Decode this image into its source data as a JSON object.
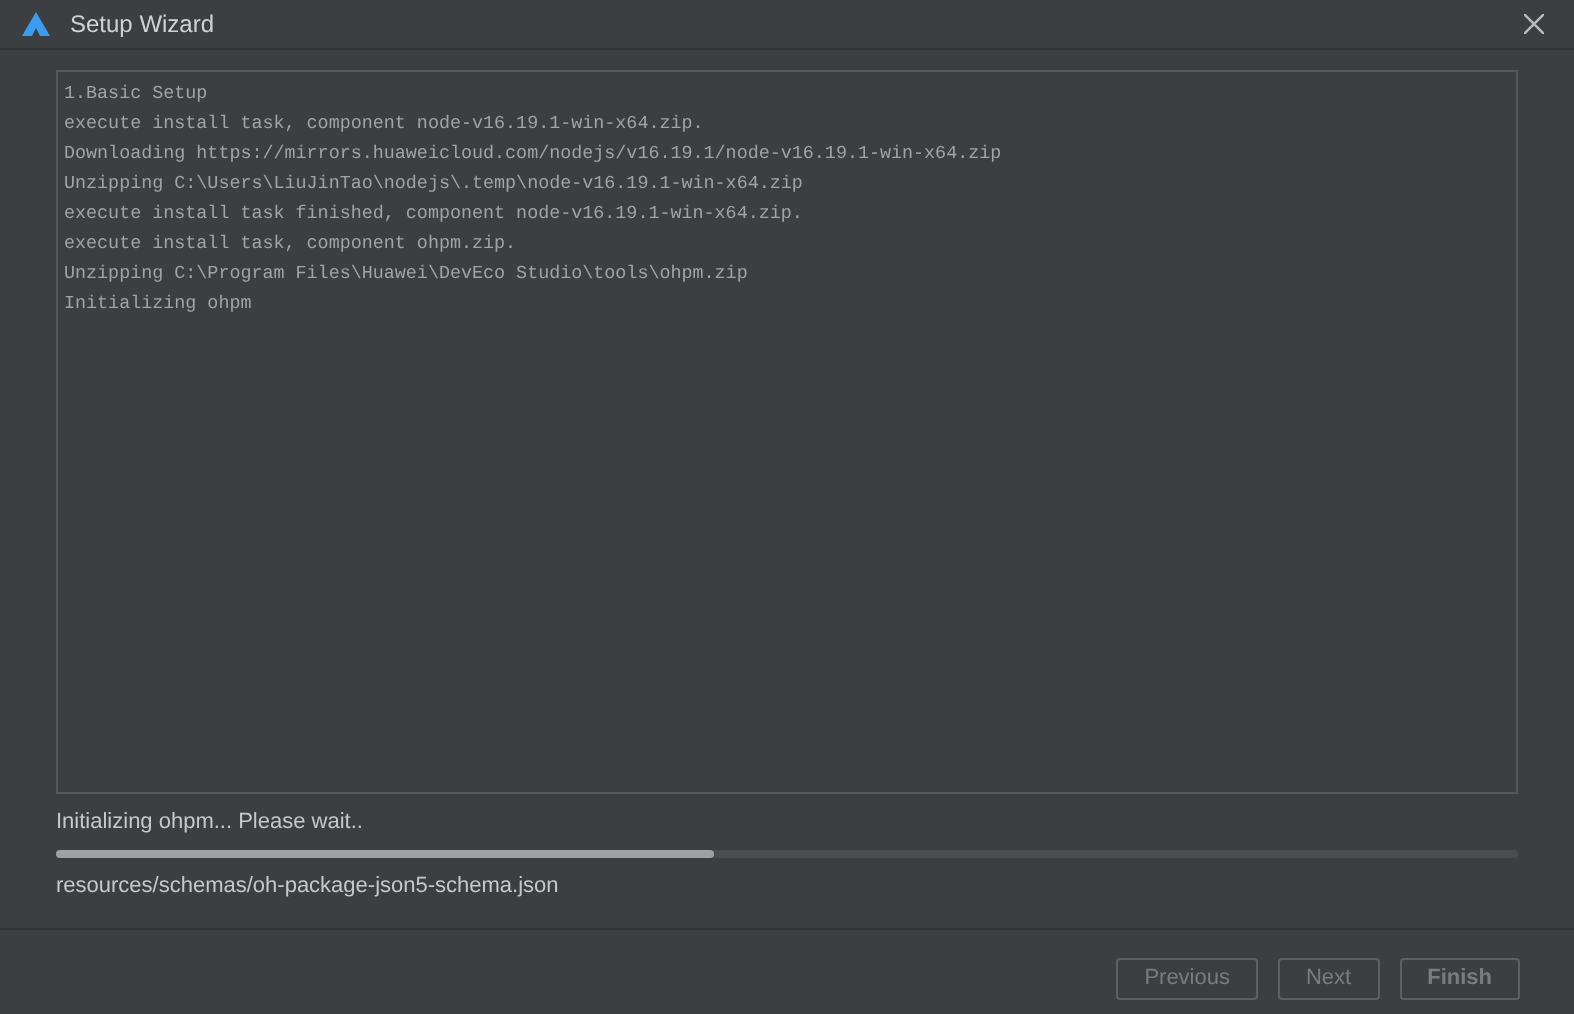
{
  "window": {
    "title": "Setup Wizard"
  },
  "log": [
    "1.Basic Setup",
    "execute install task, component node-v16.19.1-win-x64.zip.",
    "Downloading https://mirrors.huaweicloud.com/nodejs/v16.19.1/node-v16.19.1-win-x64.zip",
    "Unzipping C:\\Users\\LiuJinTao\\nodejs\\.temp\\node-v16.19.1-win-x64.zip",
    "execute install task finished, component node-v16.19.1-win-x64.zip.",
    "execute install task, component ohpm.zip.",
    "Unzipping C:\\Program Files\\Huawei\\DevEco Studio\\tools\\ohpm.zip",
    "Initializing ohpm"
  ],
  "status": "Initializing ohpm... Please wait..",
  "progress": {
    "level": 0.45
  },
  "current_file": "resources/schemas/oh-package-json5-schema.json",
  "buttons": [
    {
      "label": "Previous",
      "disabled": true,
      "bold": false
    },
    {
      "label": "Next",
      "disabled": true,
      "bold": false
    },
    {
      "label": "Finish",
      "disabled": true,
      "bold": true
    }
  ]
}
